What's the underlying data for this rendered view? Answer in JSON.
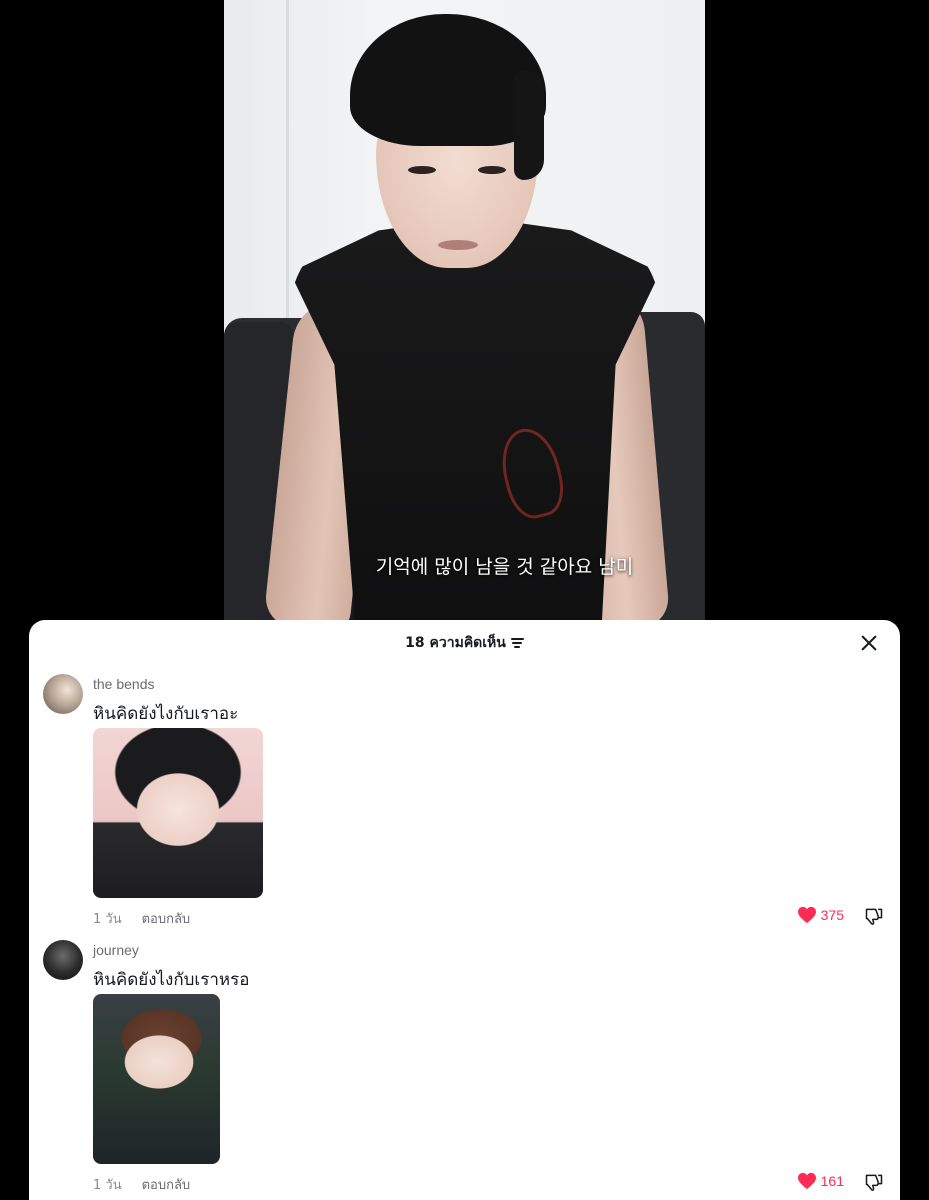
{
  "video": {
    "subtitle": "기억에 많이 남을 것 같아요 남미"
  },
  "comments_panel": {
    "count_label": "18 ความคิดเห็น",
    "sort_icon": "sort-icon",
    "close_icon": "close-icon",
    "accent_color": "#fe2c55",
    "comments": [
      {
        "username": "the bends",
        "text": "หินคิดยังไงกับเราอะ",
        "time": "1 วัน",
        "reply_label": "ตอบกลับ",
        "likes": "375"
      },
      {
        "username": "journey",
        "text": "หินคิดยังไงกับเราหรอ",
        "time": "1 วัน",
        "reply_label": "ตอบกลับ",
        "likes": "161"
      }
    ]
  }
}
